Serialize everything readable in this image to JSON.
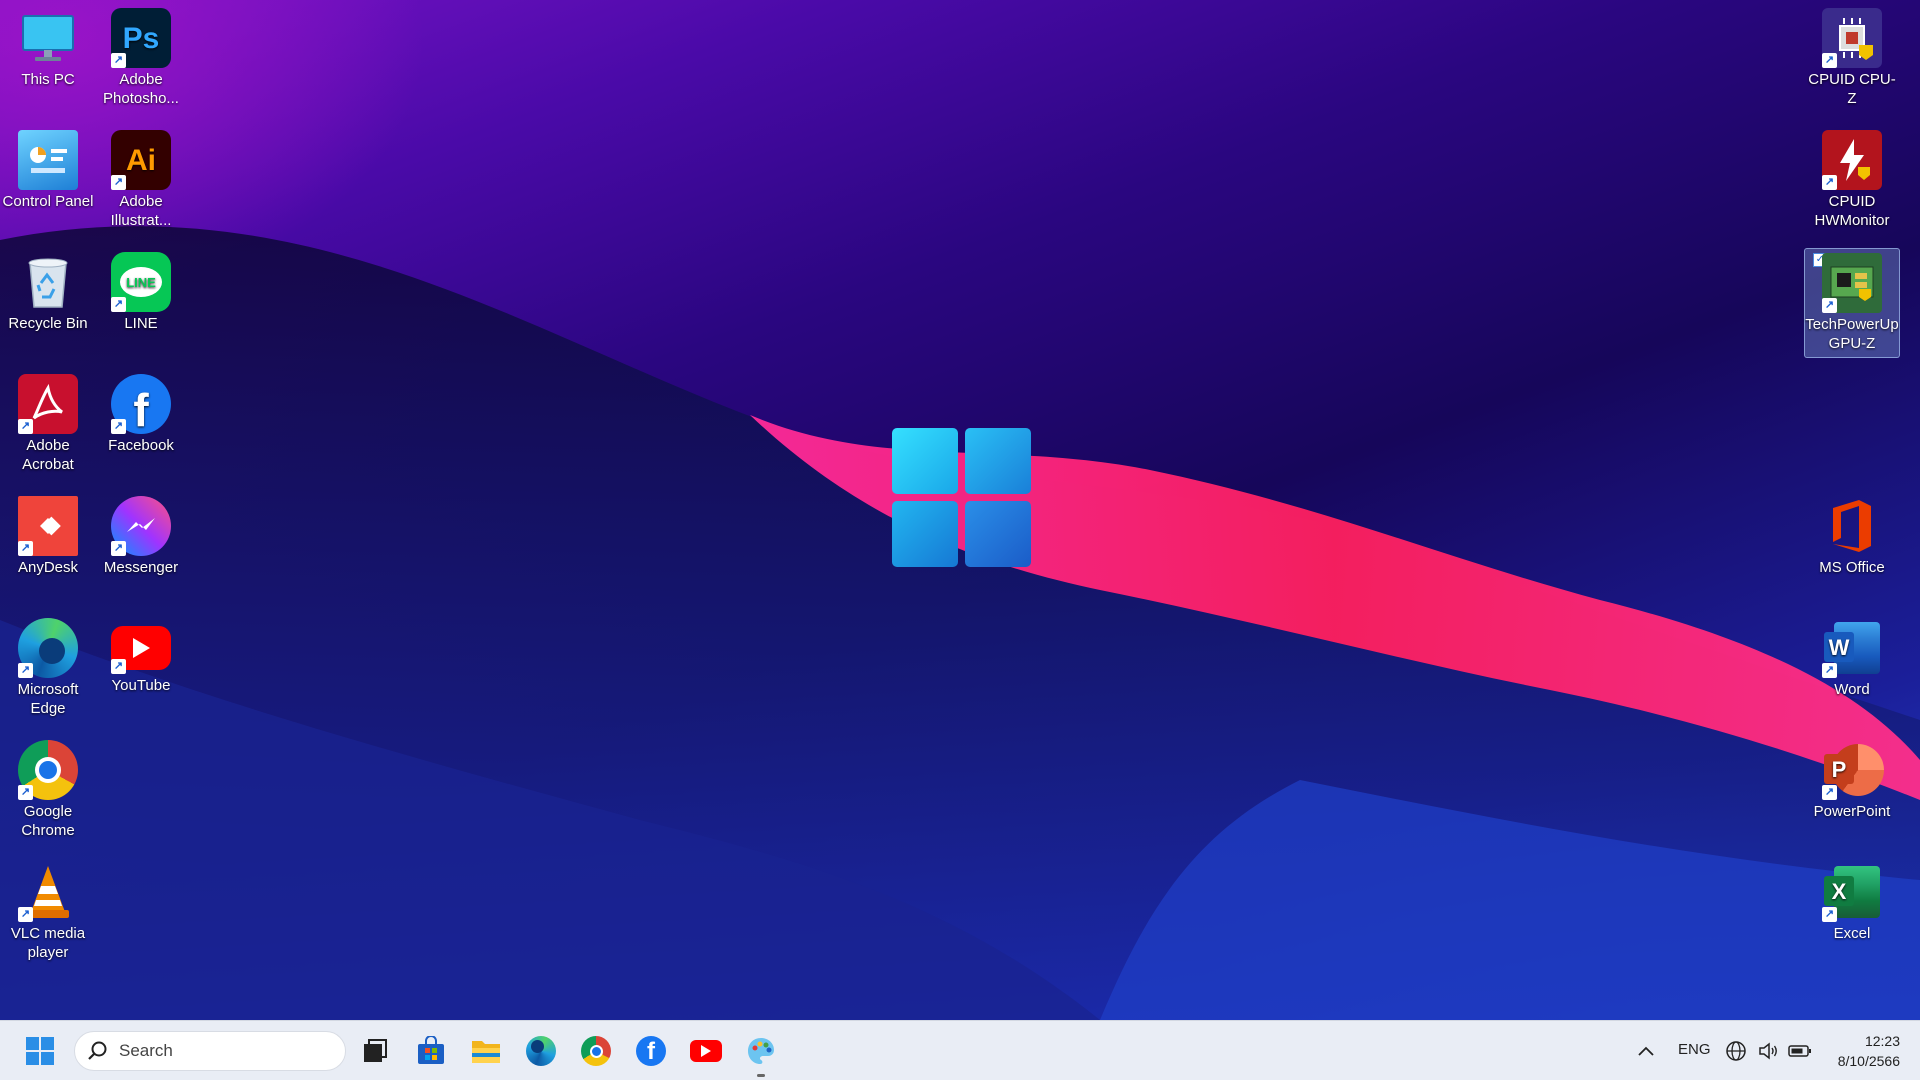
{
  "desktop": {
    "icons_left": [
      {
        "label": "This PC",
        "icon": "monitor-icon"
      },
      {
        "label": "Adobe Photosho...",
        "icon": "photoshop-icon",
        "glyph": "Ps"
      },
      {
        "label": "Control Panel",
        "icon": "control-panel-icon"
      },
      {
        "label": "Adobe Illustrat...",
        "icon": "illustrator-icon",
        "glyph": "Ai"
      },
      {
        "label": "Recycle Bin",
        "icon": "recycle-bin-icon"
      },
      {
        "label": "LINE",
        "icon": "line-icon",
        "glyph": "LINE"
      },
      {
        "label": "Adobe Acrobat",
        "icon": "acrobat-icon"
      },
      {
        "label": "Facebook",
        "icon": "facebook-icon",
        "glyph": "f"
      },
      {
        "label": "AnyDesk",
        "icon": "anydesk-icon"
      },
      {
        "label": "Messenger",
        "icon": "messenger-icon"
      },
      {
        "label": "Microsoft Edge",
        "icon": "edge-icon"
      },
      {
        "label": "YouTube",
        "icon": "youtube-icon"
      },
      {
        "label": "Google Chrome",
        "icon": "chrome-icon"
      },
      {
        "label": "VLC media player",
        "icon": "vlc-icon"
      }
    ],
    "icons_right": [
      {
        "label": "CPUID CPU-Z",
        "icon": "cpuz-icon"
      },
      {
        "label": "CPUID HWMonitor",
        "icon": "hwmonitor-icon"
      },
      {
        "label": "TechPowerUp GPU-Z",
        "icon": "gpuz-icon",
        "selected": true
      },
      {
        "label": "MS Office",
        "icon": "office-icon"
      },
      {
        "label": "Word",
        "icon": "word-icon",
        "glyph": "W"
      },
      {
        "label": "PowerPoint",
        "icon": "powerpoint-icon",
        "glyph": "P"
      },
      {
        "label": "Excel",
        "icon": "excel-icon",
        "glyph": "X"
      }
    ]
  },
  "taskbar": {
    "search_placeholder": "Search",
    "pinned": [
      "task-view-icon",
      "store-icon",
      "file-explorer-icon",
      "edge-icon",
      "chrome-icon",
      "facebook-icon",
      "youtube-icon",
      "paint-icon"
    ],
    "tray": {
      "language": "ENG",
      "time": "12:23",
      "date": "8/10/2566"
    }
  },
  "colors": {
    "taskbar_bg": "#e9edf5",
    "windows_blue": "#2a8ee6",
    "accent_pink": "#ff2a7a"
  }
}
